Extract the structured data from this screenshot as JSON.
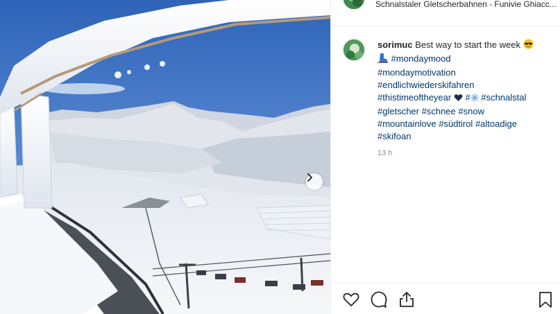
{
  "photo": {
    "alt": "Snowy alpine valley with frozen railing and ski lifts",
    "next_icon": "chevron-right-icon"
  },
  "header": {
    "location": "Schnalstaler Gletscherbahnen - Funivie Ghiacc..."
  },
  "post": {
    "username": "sorimuc",
    "caption": "Best way to start the week",
    "hashtags": [
      "#mondaymood",
      "#mondaymotivation",
      "#endlichwiederskifahren",
      "#thistimeoftheyear",
      "#",
      "#schnalstal",
      "#gletscher",
      "#schnee",
      "#snow",
      "#mountainlove",
      "#südtirol",
      "#altoadige",
      "#skifoan"
    ],
    "timestamp": "13 h"
  },
  "actions": {
    "like_icon": "heart-icon",
    "comment_icon": "comment-icon",
    "share_icon": "share-icon",
    "save_icon": "bookmark-icon"
  },
  "colors": {
    "hashtag": "#00376b",
    "text": "#262626",
    "muted": "#8e8e8e",
    "divider": "#efefef",
    "sky": "#3d74c4"
  }
}
